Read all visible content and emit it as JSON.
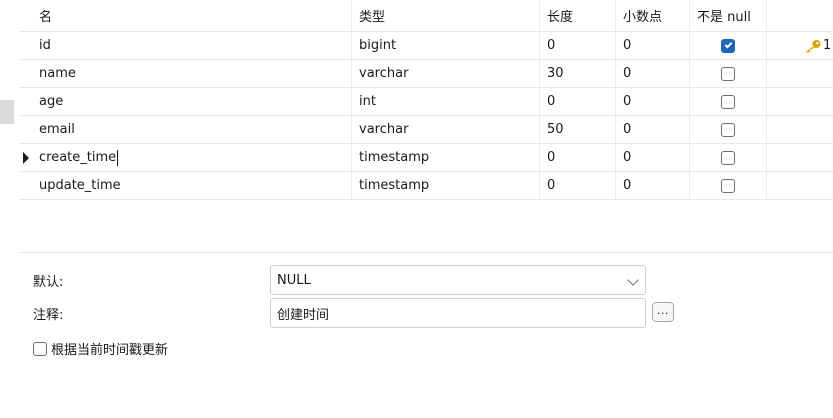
{
  "columns": {
    "name": "名",
    "type": "类型",
    "length": "长度",
    "decimals": "小数点",
    "not_null": "不是 null"
  },
  "rows": [
    {
      "name": "id",
      "type": "bigint",
      "length": "0",
      "decimals": "0",
      "not_null": true,
      "key": "1"
    },
    {
      "name": "name",
      "type": "varchar",
      "length": "30",
      "decimals": "0",
      "not_null": false,
      "key": ""
    },
    {
      "name": "age",
      "type": "int",
      "length": "0",
      "decimals": "0",
      "not_null": false,
      "key": ""
    },
    {
      "name": "email",
      "type": "varchar",
      "length": "50",
      "decimals": "0",
      "not_null": false,
      "key": ""
    },
    {
      "name": "create_time",
      "type": "timestamp",
      "length": "0",
      "decimals": "0",
      "not_null": false,
      "key": "",
      "current": true
    },
    {
      "name": "update_time",
      "type": "timestamp",
      "length": "0",
      "decimals": "0",
      "not_null": false,
      "key": ""
    }
  ],
  "panel": {
    "default_label": "默认:",
    "default_value": "NULL",
    "comment_label": "注释:",
    "comment_value": "创建时间",
    "ellipsis_label": "...",
    "update_on_current_label": "根据当前时间戳更新",
    "update_on_current_checked": false
  },
  "icons": {
    "key": "key-icon",
    "row_marker": "row-pointer-icon",
    "dropdown": "chevron-down-icon"
  },
  "colors": {
    "checked": "#1f66c2",
    "key": "#e0a400"
  }
}
